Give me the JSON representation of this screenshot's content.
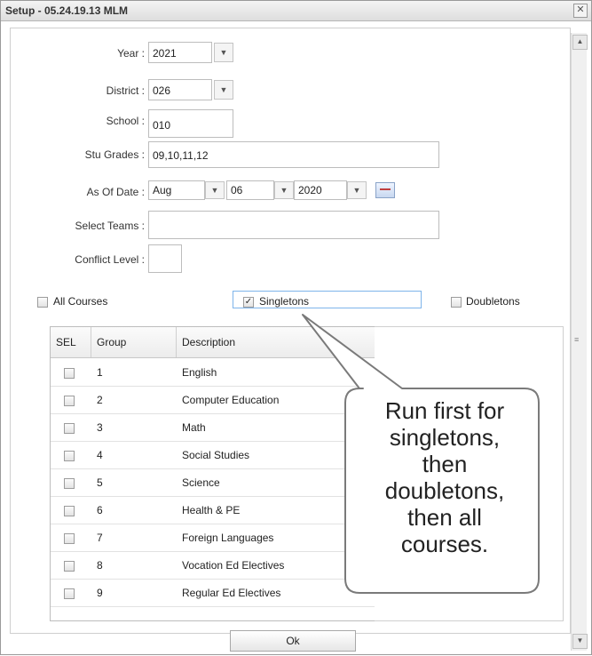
{
  "window": {
    "title": "Setup - 05.24.19.13 MLM",
    "close_glyph": "✕"
  },
  "form": {
    "year": {
      "label": "Year :",
      "value": "2021"
    },
    "district": {
      "label": "District :",
      "value": "026"
    },
    "school": {
      "label": "School :",
      "value": "010"
    },
    "stu_grades": {
      "label": "Stu Grades :",
      "value": "09,10,11,12"
    },
    "as_of_date": {
      "label": "As Of Date :",
      "month": "Aug",
      "day": "06",
      "year": "2020"
    },
    "select_teams": {
      "label": "Select Teams :",
      "value": ""
    },
    "conflict_level": {
      "label": "Conflict Level :",
      "value": ""
    }
  },
  "options": {
    "all_courses": {
      "label": "All Courses",
      "checked": false
    },
    "singletons": {
      "label": "Singletons",
      "checked": true
    },
    "doubletons": {
      "label": "Doubletons",
      "checked": false
    }
  },
  "table": {
    "columns": [
      "SEL",
      "Group",
      "Description"
    ],
    "rows": [
      {
        "group": "1",
        "description": "English"
      },
      {
        "group": "2",
        "description": "Computer Education"
      },
      {
        "group": "3",
        "description": "Math"
      },
      {
        "group": "4",
        "description": "Social Studies"
      },
      {
        "group": "5",
        "description": "Science"
      },
      {
        "group": "6",
        "description": "Health & PE"
      },
      {
        "group": "7",
        "description": "Foreign Languages"
      },
      {
        "group": "8",
        "description": "Vocation Ed Electives"
      },
      {
        "group": "9",
        "description": "Regular Ed Electives"
      }
    ]
  },
  "buttons": {
    "ok": "Ok"
  },
  "callout": {
    "lines": [
      "Run first for",
      "singletons,",
      "then",
      "doubletons,",
      "then all",
      "courses."
    ]
  },
  "icons": {
    "dropdown": "chevron-down-icon",
    "calendar": "calendar-icon",
    "close": "close-icon",
    "check": "✓"
  }
}
